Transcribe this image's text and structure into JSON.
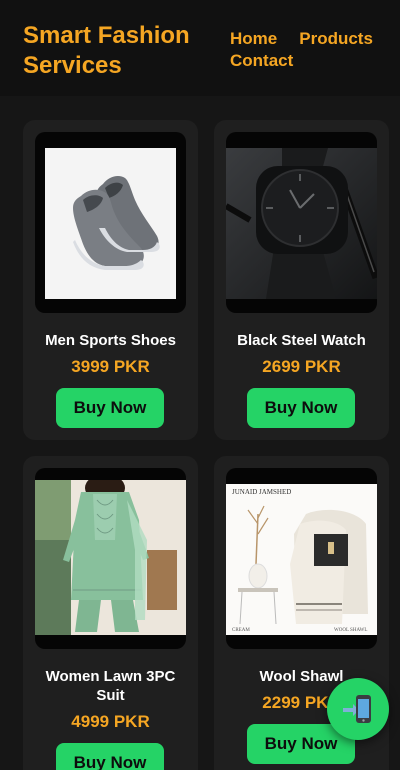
{
  "header": {
    "brand": "Smart Fashion Services",
    "nav": [
      "Home",
      "Products",
      "Contact"
    ]
  },
  "products": [
    {
      "name": "Men Sports Shoes",
      "price": "3999 PKR",
      "button": "Buy Now"
    },
    {
      "name": "Black Steel Watch",
      "price": "2699 PKR",
      "button": "Buy Now"
    },
    {
      "name": "Women Lawn 3PC Suit",
      "price": "4999 PKR",
      "button": "Buy Now"
    },
    {
      "name": "Wool Shawl",
      "price": "2299 PKR",
      "button": "Buy Now"
    }
  ],
  "shawl_image": {
    "brand_text": "JUNAID JAMSHED",
    "tag_left": "CREAM",
    "tag_right": "WOOL SHAWL"
  },
  "colors": {
    "accent": "#f5a623",
    "button": "#25d366",
    "background": "#161616",
    "card": "#1f1f1f"
  },
  "fab": {
    "icon": "mobile-phone-icon"
  }
}
